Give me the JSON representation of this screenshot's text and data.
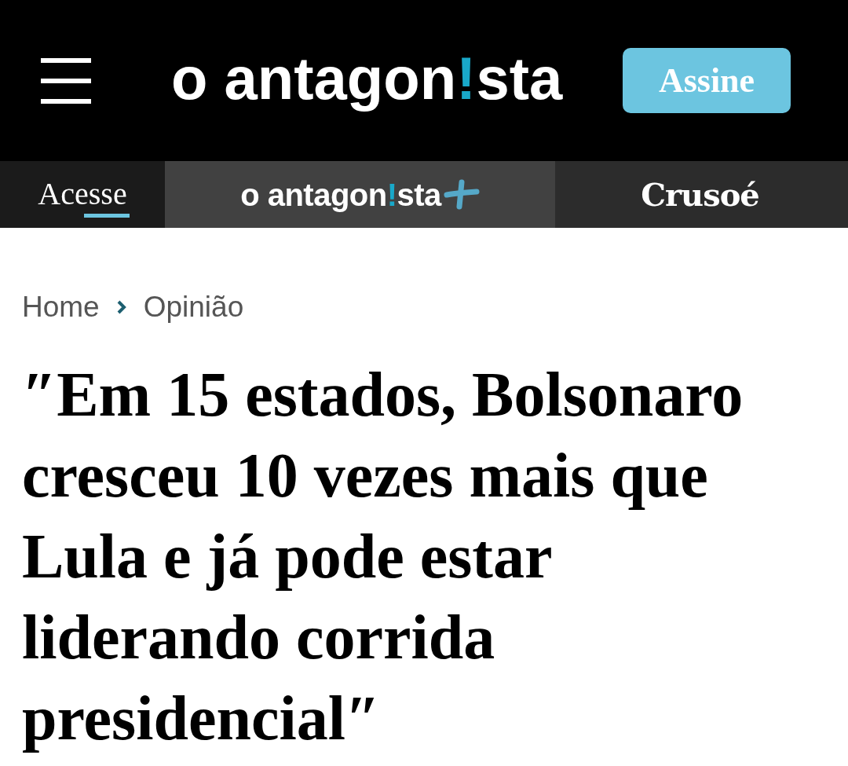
{
  "header": {
    "logo": {
      "before": "o antagon",
      "mark": "!",
      "after": "sta"
    },
    "subscribe_button": "Assine"
  },
  "nav": {
    "label": "Acesse",
    "links": [
      {
        "kind": "logo_plus",
        "before": "o antagon",
        "mark": "!",
        "after": "sta"
      },
      {
        "kind": "wordmark",
        "text": "Crusoé"
      }
    ]
  },
  "breadcrumb": [
    {
      "label": "Home"
    },
    {
      "label": "Opinião"
    }
  ],
  "headline": "″Em 15 estados, Bolsonaro cresceu 10 vezes mais que Lula e já pode estar liderando corrida presidencial″"
}
